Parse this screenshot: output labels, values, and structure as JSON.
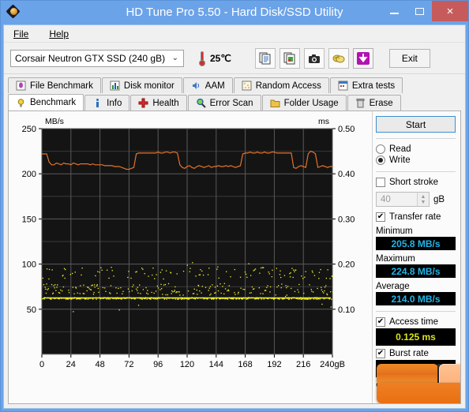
{
  "window": {
    "title": "HD Tune Pro 5.50 - Hard Disk/SSD Utility",
    "app_icon": "hdtune-diamond-icon",
    "minimize_label": "Minimize",
    "maximize_label": "Maximize",
    "close_label": "×",
    "titlebar_color": "#6ba3e8",
    "close_color": "#c75b5b"
  },
  "menu": {
    "items": [
      {
        "label": "File",
        "mnemonic": "F"
      },
      {
        "label": "Help",
        "mnemonic": "H"
      }
    ]
  },
  "toolbar": {
    "drive": "Corsair Neutron GTX SSD (240 gB)",
    "drive_options": [
      "Corsair Neutron GTX SSD (240 gB)"
    ],
    "dropdown_chevron": "⌄",
    "temperature": "25℃",
    "thermometer_icon": "thermometer-icon",
    "buttons": [
      {
        "name": "copy-text-icon",
        "label": "Copy text"
      },
      {
        "name": "copy-image-icon",
        "label": "Copy image"
      },
      {
        "name": "screenshot-camera-icon",
        "label": "Screenshot"
      },
      {
        "name": "gold-coins-icon",
        "label": "Options"
      },
      {
        "name": "download-arrow-icon",
        "label": "Download"
      }
    ],
    "exit_label": "Exit"
  },
  "tabs": {
    "row1": [
      {
        "label": "File Benchmark",
        "icon": "file-benchmark-icon",
        "selected": false
      },
      {
        "label": "Disk monitor",
        "icon": "disk-monitor-icon",
        "selected": false
      },
      {
        "label": "AAM",
        "icon": "speaker-icon",
        "selected": false
      },
      {
        "label": "Random Access",
        "icon": "random-access-icon",
        "selected": false
      },
      {
        "label": "Extra tests",
        "icon": "extra-tests-icon",
        "selected": false
      }
    ],
    "row2": [
      {
        "label": "Benchmark",
        "icon": "benchmark-bulb-icon",
        "selected": true
      },
      {
        "label": "Info",
        "icon": "info-icon",
        "selected": false
      },
      {
        "label": "Health",
        "icon": "health-cross-icon",
        "selected": false
      },
      {
        "label": "Error Scan",
        "icon": "magnifier-icon",
        "selected": false
      },
      {
        "label": "Folder Usage",
        "icon": "folder-icon",
        "selected": false
      },
      {
        "label": "Erase",
        "icon": "trash-icon",
        "selected": false
      }
    ]
  },
  "controls": {
    "start_label": "Start",
    "mode_read_label": "Read",
    "mode_write_label": "Write",
    "mode_selected": "Write",
    "short_stroke_label": "Short stroke",
    "short_stroke_checked": false,
    "short_stroke_value": "40",
    "short_stroke_unit": "gB",
    "spinner_up": "▲",
    "spinner_down": "▼",
    "transfer_rate_label": "Transfer rate",
    "transfer_rate_checked": true,
    "check_glyph": "✔",
    "minimum_label": "Minimum",
    "minimum_value": "205.8 MB/s",
    "maximum_label": "Maximum",
    "maximum_value": "224.8 MB/s",
    "average_label": "Average",
    "average_value": "214.0 MB/s",
    "access_time_label": "Access time",
    "access_time_checked": true,
    "access_time_value": "0.125 ms",
    "burst_rate_label": "Burst rate",
    "burst_rate_checked": true,
    "cpu_label": "C",
    "value_color_cyan": "#22b6e8",
    "value_color_yellow": "#d8e317"
  },
  "chart_data": {
    "type": "line",
    "title": "",
    "xlabel": "240gB",
    "ylabel": "MB/s",
    "y2label": "ms",
    "xlim": [
      0,
      240
    ],
    "ylim": [
      0,
      250
    ],
    "y2lim": [
      0,
      0.5
    ],
    "xticks": [
      0,
      24,
      48,
      72,
      96,
      120,
      144,
      168,
      192,
      216,
      240
    ],
    "xticklabels": [
      "0",
      "24",
      "48",
      "72",
      "96",
      "120",
      "144",
      "168",
      "192",
      "216",
      "240gB"
    ],
    "yticks": [
      50,
      100,
      150,
      200,
      250
    ],
    "yticklabels": [
      "50",
      "100",
      "150",
      "200",
      "250"
    ],
    "y2ticks": [
      0.1,
      0.2,
      0.3,
      0.4,
      0.5
    ],
    "y2ticklabels": [
      "0.10",
      "0.20",
      "0.30",
      "0.40",
      "0.50"
    ],
    "grid": true,
    "background": "#141414",
    "grid_color": "#5a5a5a",
    "legend": null,
    "series": [
      {
        "name": "Transfer rate",
        "type": "line",
        "axis": "left",
        "color": "#e3732a",
        "units": "MB/s",
        "x": [
          0,
          2,
          4,
          6,
          8,
          10,
          12,
          14,
          16,
          18,
          20,
          22,
          24,
          26,
          28,
          30,
          32,
          34,
          36,
          38,
          40,
          42,
          44,
          46,
          48,
          50,
          52,
          54,
          56,
          58,
          60,
          62,
          64,
          66,
          68,
          70,
          72,
          74,
          76,
          78,
          80,
          82,
          84,
          86,
          88,
          90,
          92,
          94,
          96,
          98,
          100,
          102,
          104,
          106,
          108,
          110,
          112,
          114,
          116,
          118,
          120,
          122,
          124,
          126,
          128,
          130,
          132,
          134,
          136,
          138,
          140,
          142,
          144,
          146,
          148,
          150,
          152,
          154,
          156,
          158,
          160,
          162,
          164,
          166,
          168,
          170,
          172,
          174,
          176,
          178,
          180,
          182,
          184,
          186,
          188,
          190,
          192,
          194,
          196,
          198,
          200,
          202,
          204,
          206,
          208,
          210,
          212,
          214,
          216,
          218,
          220,
          222,
          224,
          226,
          228,
          230,
          232,
          234,
          236,
          238,
          240
        ],
        "y": [
          222,
          222,
          222,
          213,
          210,
          210,
          212,
          211,
          210,
          212,
          211,
          211,
          210,
          212,
          211,
          210,
          211,
          211,
          211,
          211,
          210,
          211,
          210,
          210,
          210,
          210,
          209,
          209,
          209,
          209,
          208,
          208,
          208,
          207,
          206,
          205,
          205,
          206,
          207,
          222,
          223,
          223,
          223,
          223,
          223,
          223,
          223,
          223,
          224,
          223,
          223,
          224,
          224,
          223,
          224,
          224,
          223,
          210,
          207,
          206,
          208,
          209,
          207,
          206,
          208,
          209,
          208,
          207,
          208,
          209,
          207,
          208,
          208,
          209,
          208,
          208,
          209,
          208,
          209,
          208,
          207,
          208,
          209,
          222,
          223,
          223,
          224,
          223,
          223,
          224,
          223,
          223,
          224,
          223,
          223,
          224,
          224,
          223,
          223,
          223,
          223,
          223,
          223,
          223,
          207,
          206,
          208,
          209,
          208,
          207,
          222,
          225,
          224,
          222,
          207,
          208,
          209,
          208,
          207,
          208,
          208
        ]
      },
      {
        "name": "Access time",
        "type": "scatter",
        "axis": "right",
        "color": "#f5f526",
        "units": "ms",
        "baseline_ms": 0.125,
        "cluster_ms": [
          0.125,
          0.15,
          0.185
        ],
        "point_count": 620,
        "min_ms": 0.095,
        "max_ms": 0.205
      }
    ],
    "annotations": []
  }
}
